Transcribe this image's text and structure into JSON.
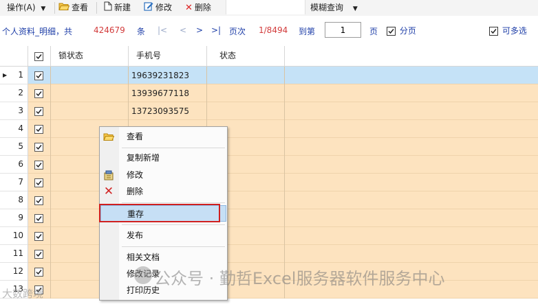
{
  "toolbar": {
    "operations": "操作(A)",
    "view": "查看",
    "new": "新建",
    "edit": "修改",
    "delete": "删除",
    "fuzzy_query": "模糊查询"
  },
  "infobar": {
    "title": "个人资料_明细，共",
    "total": "424679",
    "total_unit": "条",
    "nav_first": "|<",
    "nav_prev": "<",
    "nav_next": ">",
    "nav_last": ">|",
    "page_label": "页次",
    "page_value": "1/8494",
    "goto_label": "到第",
    "goto_value": "1",
    "goto_unit": "页",
    "paging_label": "分页",
    "multi_select_label": "可多选"
  },
  "grid": {
    "headers": [
      "锁状态",
      "手机号",
      "状态"
    ],
    "rows": [
      {
        "n": "1",
        "phone": "19639231823",
        "selected": true
      },
      {
        "n": "2",
        "phone": "13939677118"
      },
      {
        "n": "3",
        "phone": "13723093575"
      },
      {
        "n": "4",
        "phone": ""
      },
      {
        "n": "5",
        "phone": ""
      },
      {
        "n": "6",
        "phone": ""
      },
      {
        "n": "7",
        "phone": ""
      },
      {
        "n": "8",
        "phone": ""
      },
      {
        "n": "9",
        "phone": ""
      },
      {
        "n": "10",
        "phone": ""
      },
      {
        "n": "11",
        "phone": ""
      },
      {
        "n": "12",
        "phone": ""
      },
      {
        "n": "13",
        "phone": ""
      }
    ]
  },
  "context_menu": {
    "view": "查看",
    "copy_new": "复制新增",
    "edit": "修改",
    "delete": "删除",
    "resave": "重存",
    "publish": "发布",
    "related_docs": "相关文档",
    "edit_log": "修改记录",
    "print_history": "打印历史"
  },
  "watermark": {
    "text": "公众号 · 勤哲Excel服务器软件服务中心",
    "text2": "大数跨境"
  },
  "colors": {
    "row_bg": "#fde3bf",
    "selected_row_bg": "#c5e2f7",
    "link_blue": "#1f3fa8",
    "count_red": "#d23b3b",
    "highlight_border": "#d01f1f"
  }
}
